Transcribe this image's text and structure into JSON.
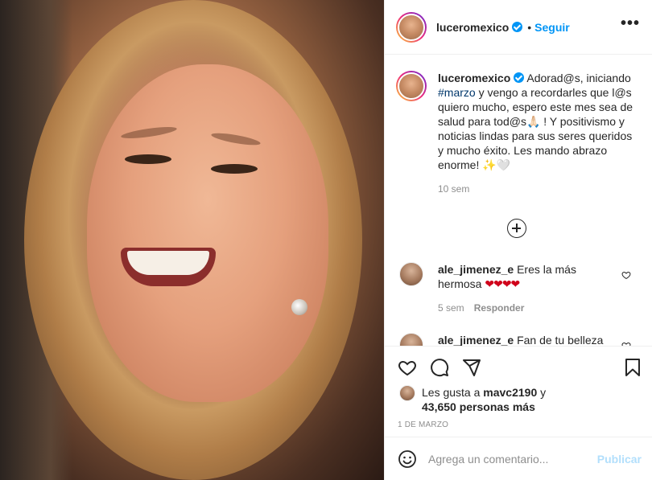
{
  "post": {
    "username": "luceromexico",
    "follow_label": "Seguir",
    "more_label": "•••",
    "caption": {
      "username": "luceromexico",
      "text_before_tag": "Adorad@s, iniciando",
      "hashtag": "#marzo",
      "text_after_tag": " y vengo a recordarles que l@s quiero mucho, espero este mes sea de salud para tod@s🙏🏻 ! Y positivismo y noticias lindas para sus seres queridos y mucho éxito. Les mando abrazo enorme! ✨🤍",
      "time": "10 sem"
    },
    "comments": [
      {
        "username": "ale_jimenez_e",
        "text": "Eres la más hermosa",
        "emoji": "❤❤❤❤",
        "time": "5 sem",
        "reply_label": "Responder"
      },
      {
        "username": "ale_jimenez_e",
        "text": "Fan de tu belleza",
        "emoji": "",
        "time": "",
        "reply_label": ""
      }
    ],
    "likes": {
      "prefix": "Les gusta a",
      "liked_by": "mavc2190",
      "connector": "y",
      "others": "43,650 personas más"
    },
    "date": "1 DE MARZO",
    "comment_input": {
      "placeholder": "Agrega un comentario...",
      "publish_label": "Publicar"
    },
    "colors": {
      "accent": "#0095f6",
      "muted": "#8e8e8e",
      "hashtag": "#00376b",
      "publish_disabled": "#b2dffc"
    },
    "icons": [
      "verified-badge-icon",
      "more-options-icon",
      "load-more-icon",
      "heart-icon",
      "comment-icon",
      "share-icon",
      "bookmark-icon",
      "emoji-icon"
    ]
  }
}
